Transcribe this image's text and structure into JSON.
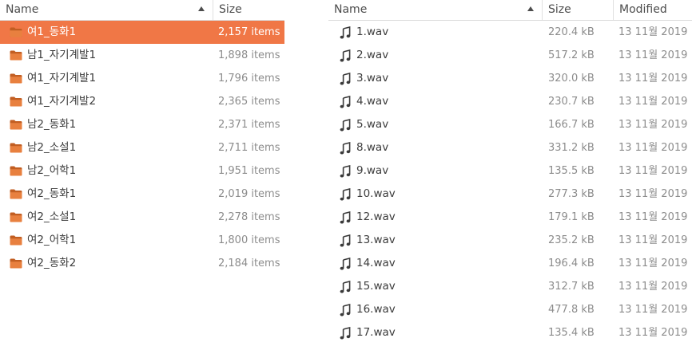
{
  "left": {
    "columns": {
      "name": "Name",
      "size": "Size"
    },
    "folders": [
      {
        "name": "여1_동화1",
        "size": "2,157 items",
        "selected": true
      },
      {
        "name": "남1_자기계발1",
        "size": "1,898 items"
      },
      {
        "name": "여1_자기계발1",
        "size": "1,796 items"
      },
      {
        "name": "여1_자기계발2",
        "size": "2,365 items"
      },
      {
        "name": "남2_동화1",
        "size": "2,371 items"
      },
      {
        "name": "남2_소설1",
        "size": "2,711 items"
      },
      {
        "name": "남2_어학1",
        "size": "1,951 items"
      },
      {
        "name": "여2_동화1",
        "size": "2,019 items"
      },
      {
        "name": "여2_소설1",
        "size": "2,278 items"
      },
      {
        "name": "여2_어학1",
        "size": "1,800 items"
      },
      {
        "name": "여2_동화2",
        "size": "2,184 items"
      }
    ]
  },
  "right": {
    "columns": {
      "name": "Name",
      "size": "Size",
      "modified": "Modified"
    },
    "files": [
      {
        "name": "1.wav",
        "size": "220.4 kB",
        "modified": "13 11월 2019"
      },
      {
        "name": "2.wav",
        "size": "517.2 kB",
        "modified": "13 11월 2019"
      },
      {
        "name": "3.wav",
        "size": "320.0 kB",
        "modified": "13 11월 2019"
      },
      {
        "name": "4.wav",
        "size": "230.7 kB",
        "modified": "13 11월 2019"
      },
      {
        "name": "5.wav",
        "size": "166.7 kB",
        "modified": "13 11월 2019"
      },
      {
        "name": "8.wav",
        "size": "331.2 kB",
        "modified": "13 11월 2019"
      },
      {
        "name": "9.wav",
        "size": "135.5 kB",
        "modified": "13 11월 2019"
      },
      {
        "name": "10.wav",
        "size": "277.3 kB",
        "modified": "13 11월 2019"
      },
      {
        "name": "12.wav",
        "size": "179.1 kB",
        "modified": "13 11월 2019"
      },
      {
        "name": "13.wav",
        "size": "235.2 kB",
        "modified": "13 11월 2019"
      },
      {
        "name": "14.wav",
        "size": "196.4 kB",
        "modified": "13 11월 2019"
      },
      {
        "name": "15.wav",
        "size": "312.7 kB",
        "modified": "13 11월 2019"
      },
      {
        "name": "16.wav",
        "size": "477.8 kB",
        "modified": "13 11월 2019"
      },
      {
        "name": "17.wav",
        "size": "135.4 kB",
        "modified": "13 11월 2019"
      }
    ]
  },
  "colors": {
    "selection": "#f07746",
    "folder": "#e8803f",
    "folder_dark": "#c25e22",
    "muted_text": "#8c8c8c"
  },
  "icons": {
    "folder": "folder-icon",
    "audio": "audio-file-icon"
  }
}
